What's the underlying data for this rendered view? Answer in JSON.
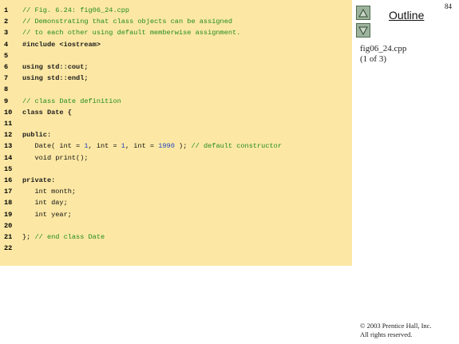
{
  "slide": {
    "page_number": "84",
    "outline_label": "Outline",
    "file_name": "fig06_24.cpp",
    "file_part": "(1 of 3)",
    "copyright_line1": "© 2003 Prentice Hall, Inc.",
    "copyright_line2": "All rights reserved.",
    "nav_up_icon": "triangle-up-icon",
    "nav_down_icon": "triangle-down-icon"
  },
  "code": {
    "lines": [
      {
        "num": "1",
        "tokens": [
          {
            "t": "c",
            "v": "// Fig. 6.24: fig06_24.cpp"
          }
        ]
      },
      {
        "num": "2",
        "tokens": [
          {
            "t": "c",
            "v": "// Demonstrating that class objects can be assigned"
          }
        ]
      },
      {
        "num": "3",
        "tokens": [
          {
            "t": "c",
            "v": "// to each other using default memberwise assignment."
          }
        ]
      },
      {
        "num": "4",
        "tokens": [
          {
            "t": "k",
            "v": "#include <iostream>"
          }
        ]
      },
      {
        "num": "5",
        "tokens": []
      },
      {
        "num": "6",
        "tokens": [
          {
            "t": "k",
            "v": "using std::cout;"
          }
        ]
      },
      {
        "num": "7",
        "tokens": [
          {
            "t": "k",
            "v": "using std::endl;"
          }
        ]
      },
      {
        "num": "8",
        "tokens": []
      },
      {
        "num": "9",
        "tokens": [
          {
            "t": "c",
            "v": "// class Date definition"
          }
        ]
      },
      {
        "num": "10",
        "tokens": [
          {
            "t": "k",
            "v": "class Date {"
          }
        ]
      },
      {
        "num": "11",
        "tokens": []
      },
      {
        "num": "12",
        "tokens": [
          {
            "t": "k",
            "v": "public:"
          }
        ]
      },
      {
        "num": "13",
        "tokens": [
          {
            "t": "p",
            "v": "   Date( int = "
          },
          {
            "t": "n",
            "v": "1"
          },
          {
            "t": "p",
            "v": ", int = "
          },
          {
            "t": "n",
            "v": "1"
          },
          {
            "t": "p",
            "v": ", int = "
          },
          {
            "t": "n",
            "v": "1990"
          },
          {
            "t": "p",
            "v": " ); "
          },
          {
            "t": "c",
            "v": "// default constructor"
          }
        ]
      },
      {
        "num": "14",
        "tokens": [
          {
            "t": "p",
            "v": "   void print();"
          }
        ]
      },
      {
        "num": "15",
        "tokens": []
      },
      {
        "num": "16",
        "tokens": [
          {
            "t": "k",
            "v": "private:"
          }
        ]
      },
      {
        "num": "17",
        "tokens": [
          {
            "t": "p",
            "v": "   int month;"
          }
        ]
      },
      {
        "num": "18",
        "tokens": [
          {
            "t": "p",
            "v": "   int day;"
          }
        ]
      },
      {
        "num": "19",
        "tokens": [
          {
            "t": "p",
            "v": "   int year;"
          }
        ]
      },
      {
        "num": "20",
        "tokens": []
      },
      {
        "num": "21",
        "tokens": [
          {
            "t": "p",
            "v": "}; "
          },
          {
            "t": "c",
            "v": "// end class Date"
          }
        ]
      },
      {
        "num": "22",
        "tokens": []
      }
    ]
  },
  "colors": {
    "code_background": "#fce8a4",
    "comment": "#248a24",
    "number": "#2244bb",
    "nav_button": "#9db39d"
  }
}
